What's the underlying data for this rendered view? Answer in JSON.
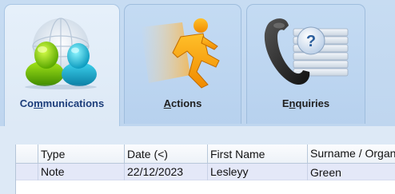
{
  "tabs": [
    {
      "id": "communications",
      "label_pre": "Co",
      "label_underline": "m",
      "label_post": "munications",
      "icon": "two-people-globe-icon",
      "active": true
    },
    {
      "id": "actions",
      "label_pre": "",
      "label_underline": "A",
      "label_post": "ctions",
      "icon": "running-man-icon",
      "active": false
    },
    {
      "id": "enquiries",
      "label_pre": "E",
      "label_underline": "n",
      "label_post": "quiries",
      "icon": "telephone-question-icon",
      "active": false
    }
  ],
  "grid": {
    "columns": [
      "Type",
      "Date (<)",
      "First Name",
      "Surname / Organisation"
    ],
    "rows": [
      {
        "type": "Note",
        "date": "22/12/2023",
        "first_name": "Lesleyy",
        "surname": "Green"
      }
    ]
  },
  "colors": {
    "background": "#c8ddf2",
    "active_tab_label": "#1c3d7a",
    "selected_row": "#e4e8f8"
  }
}
